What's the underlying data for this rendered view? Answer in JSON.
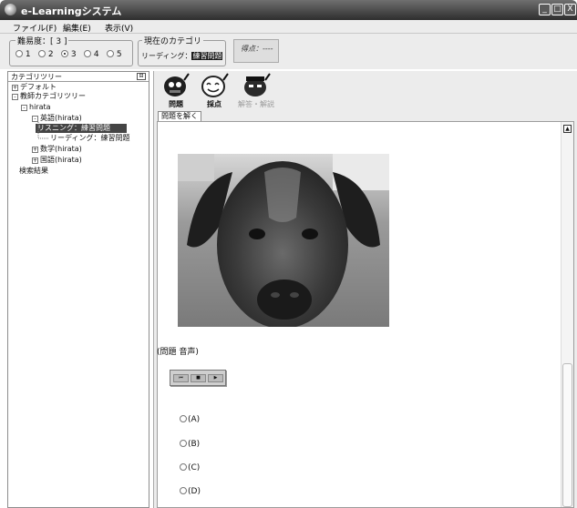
{
  "window": {
    "title": "e-Learningシステム",
    "controls": [
      "_",
      "□",
      "X"
    ]
  },
  "menu": {
    "items": [
      "ファイル(F)",
      "編集(E)",
      "表示(V)"
    ]
  },
  "difficulty": {
    "label": "難易度：[ 3 ]",
    "options": [
      "1",
      "2",
      "3",
      "4",
      "5"
    ],
    "selected": "3"
  },
  "current_category": {
    "legend": "現在のカテゴリ",
    "prefix": "リーディング：",
    "value": "練習問題"
  },
  "score": {
    "text": "得点：----"
  },
  "tree": {
    "header": "カテゴリツリー",
    "header_button": "⊟",
    "rows": [
      {
        "expander": "+",
        "label": "デフォルト"
      },
      {
        "expander": "-",
        "label": "教師カテゴリツリー"
      },
      {
        "expander": "-",
        "label": "hirata"
      },
      {
        "expander": "-",
        "label": "英語(hirata)"
      },
      {
        "expander": "",
        "label": "リスニング：練習問題"
      },
      {
        "expander": "",
        "label": "リーディング：練習問題"
      },
      {
        "expander": "+",
        "label": "数学(hirata)"
      },
      {
        "expander": "+",
        "label": "国語(hirata)"
      },
      {
        "expander": "",
        "label": "検索結果"
      }
    ]
  },
  "toolbar": {
    "buttons": [
      {
        "label": "問題",
        "icon": "question-robot-icon",
        "enabled": true
      },
      {
        "label": "採点",
        "icon": "grading-robot-icon",
        "enabled": true
      },
      {
        "label": "解答・解説",
        "icon": "answer-robot-icon",
        "enabled": false
      }
    ]
  },
  "tabs": [
    {
      "label": "問題を解く"
    }
  ],
  "question": {
    "image": "dog-photo",
    "title": "(問題 音声)",
    "player_buttons": [
      "⏮",
      "■",
      "▶"
    ],
    "choices": [
      "(A)",
      "(B)",
      "(C)",
      "(D)"
    ]
  },
  "scrollbar": {
    "up_arrow": "▲"
  }
}
